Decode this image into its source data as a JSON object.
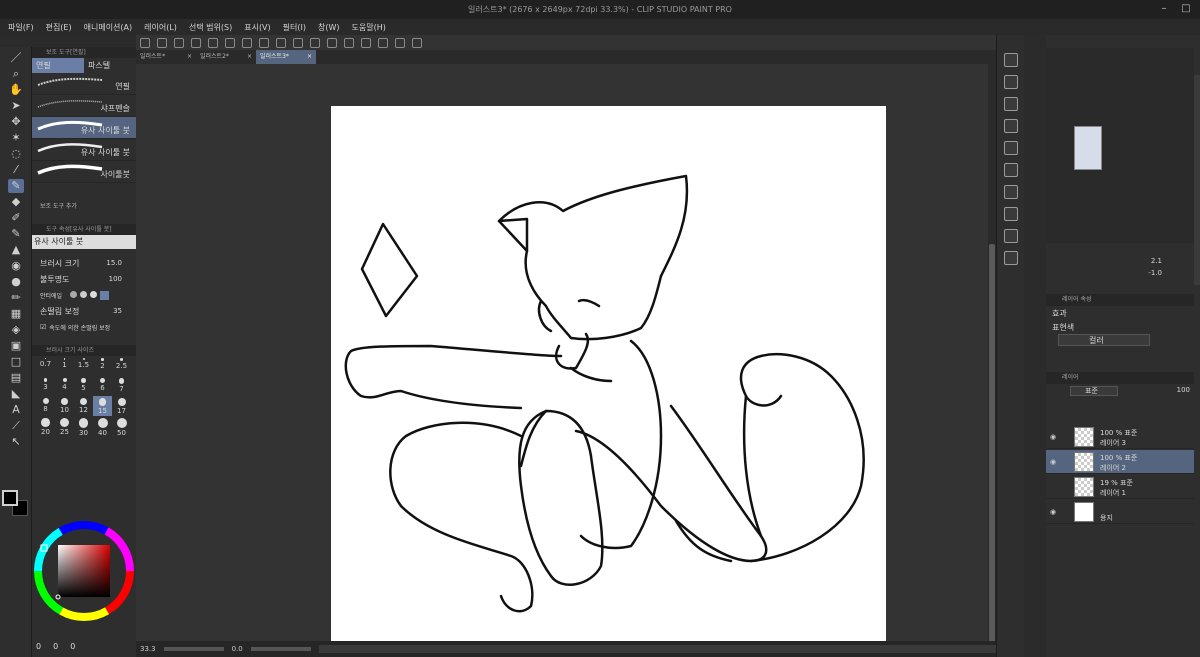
{
  "window": {
    "title": "일러스트3* (2676 x 2649px 72dpi 33.3%)  - CLIP STUDIO PAINT PRO"
  },
  "menu": [
    "파일(F)",
    "편집(E)",
    "애니메이션(A)",
    "레이어(L)",
    "선택 범위(S)",
    "표시(V)",
    "필터(I)",
    "창(W)",
    "도움말(H)"
  ],
  "sub_tool": {
    "header": "보조 도구[연필]",
    "tabs": [
      "연필",
      "파스텔"
    ],
    "brushes": [
      "연필",
      "샤프펜슬",
      "유사 사이툴 붓",
      "유사 사이툴 붓",
      "사이툴붓"
    ],
    "add_label": "보조 도구 추가"
  },
  "tool_property": {
    "header": "도구 속성[유사 사이툴 붓]",
    "preview_name": "유사 사이툴 붓",
    "brush_size_label": "브러시 크기",
    "brush_size_value": "15.0",
    "opacity_label": "불투명도",
    "opacity_value": "100",
    "anti_alias_label": "안티에일",
    "stabilization_label": "손떨림 보정",
    "stabilization_value": "35",
    "speed_label": "속도에 의한 손떨림 보정"
  },
  "brush_size_panel": {
    "header": "브러시 크기 사이즈",
    "sizes": [
      "0.7",
      "1",
      "1.5",
      "2",
      "2.5",
      "3",
      "4",
      "5",
      "6",
      "7",
      "8",
      "10",
      "12",
      "15",
      "17",
      "20",
      "25",
      "30",
      "40",
      "50"
    ],
    "selected": "15"
  },
  "color": {
    "main": "#000000",
    "sub": "#000000",
    "wheel_values": [
      "0",
      "0",
      "0"
    ]
  },
  "document_tabs": [
    {
      "label": "일러스트*",
      "active": false
    },
    {
      "label": "일러스트2*",
      "active": false
    },
    {
      "label": "일러스트3*",
      "active": true
    }
  ],
  "status": {
    "zoom": "33.3",
    "angle": "0.0"
  },
  "navigator": {
    "zoom": "2.1",
    "rotation": "-1.0"
  },
  "layer_property": {
    "header": "레이어 속성",
    "effect_label": "효과",
    "expression_label": "표현색",
    "expression_value": "컬러"
  },
  "layer_panel": {
    "header": "레이어",
    "blend_mode": "표준",
    "opacity": "100",
    "layers": [
      {
        "top": "100 % 표준",
        "name": "레이어 3",
        "selected": false,
        "visible": true
      },
      {
        "top": "100 % 표준",
        "name": "레이어 2",
        "selected": true,
        "visible": true
      },
      {
        "top": "19 % 표준",
        "name": "레이어 1",
        "selected": false,
        "visible": false
      },
      {
        "top": "",
        "name": "용지",
        "selected": false,
        "visible": true
      }
    ]
  },
  "colors": {
    "accent": "#6a7ea6",
    "selected_row": "#56657f",
    "panel": "#2e2e2e",
    "canvas_bg": "#333333",
    "paper": "#ffffff"
  }
}
